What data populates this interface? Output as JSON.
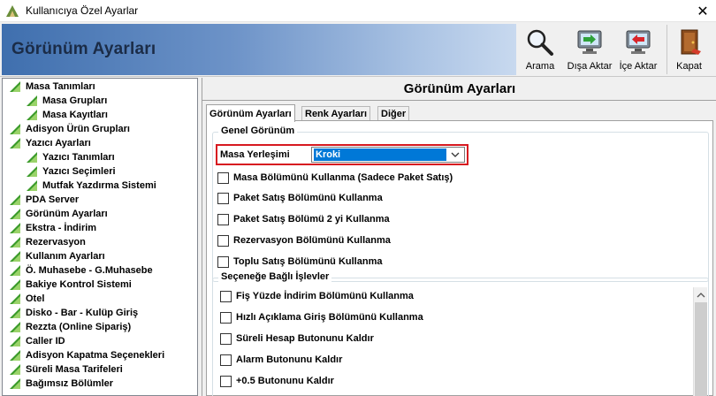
{
  "window": {
    "title": "Kullanıcıya Özel Ayarlar",
    "close_glyph": "✕"
  },
  "header": {
    "title": "Görünüm Ayarları"
  },
  "toolbar": {
    "search": {
      "label": "Arama",
      "icon": "magnifier-icon"
    },
    "export": {
      "label": "Dışa Aktar",
      "icon": "export-monitor-icon"
    },
    "import": {
      "label": "İçe Aktar",
      "icon": "import-monitor-icon"
    },
    "close": {
      "label": "Kapat",
      "icon": "exit-door-icon"
    }
  },
  "tree": [
    {
      "label": "Masa Tanımları",
      "level": 0
    },
    {
      "label": "Masa Grupları",
      "level": 1
    },
    {
      "label": "Masa Kayıtları",
      "level": 1
    },
    {
      "label": "Adisyon Ürün Grupları",
      "level": 0
    },
    {
      "label": "Yazıcı Ayarları",
      "level": 0
    },
    {
      "label": "Yazıcı Tanımları",
      "level": 1
    },
    {
      "label": "Yazıcı Seçimleri",
      "level": 1
    },
    {
      "label": "Mutfak Yazdırma Sistemi",
      "level": 1
    },
    {
      "label": "PDA Server",
      "level": 0
    },
    {
      "label": "Görünüm Ayarları",
      "level": 0
    },
    {
      "label": "Ekstra - İndirim",
      "level": 0
    },
    {
      "label": "Rezervasyon",
      "level": 0
    },
    {
      "label": "Kullanım Ayarları",
      "level": 0
    },
    {
      "label": "Ö. Muhasebe - G.Muhasebe",
      "level": 0
    },
    {
      "label": "Bakiye Kontrol Sistemi",
      "level": 0
    },
    {
      "label": "Otel",
      "level": 0
    },
    {
      "label": "Disko - Bar - Kulüp Giriş",
      "level": 0
    },
    {
      "label": "Rezzta (Online Sipariş)",
      "level": 0
    },
    {
      "label": "Caller ID",
      "level": 0
    },
    {
      "label": "Adisyon Kapatma Seçenekleri",
      "level": 0
    },
    {
      "label": "Süreli Masa Tarifeleri",
      "level": 0
    },
    {
      "label": "Bağımsız Bölümler",
      "level": 0
    }
  ],
  "panel": {
    "title": "Görünüm Ayarları",
    "tabs": [
      "Görünüm Ayarları",
      "Renk Ayarları",
      "Diğer"
    ],
    "active_tab": "Görünüm Ayarları",
    "general_group": {
      "legend": "Genel Görünüm",
      "placement_label": "Masa Yerleşimi",
      "placement_value": "Kroki",
      "checkboxes": [
        {
          "label": "Masa Bölümünü Kullanma (Sadece Paket Satış)",
          "checked": false
        },
        {
          "label": "Paket Satış Bölümünü Kullanma",
          "checked": false
        },
        {
          "label": "Paket Satış Bölümü 2 yi Kullanma",
          "checked": false
        },
        {
          "label": "Rezervasyon Bölümünü Kullanma",
          "checked": false
        },
        {
          "label": "Toplu Satış Bölümünü Kullanma",
          "checked": false
        }
      ]
    },
    "dependent_group": {
      "legend": "Seçeneğe Bağlı İşlevler",
      "checkboxes": [
        {
          "label": "Fiş Yüzde İndirim Bölümünü Kullanma",
          "checked": false
        },
        {
          "label": "Hızlı Açıklama Giriş Bölümünü Kullanma",
          "checked": false
        },
        {
          "label": "Süreli Hesap Butonunu Kaldır",
          "checked": false
        },
        {
          "label": "Alarm Butonunu Kaldır",
          "checked": false
        },
        {
          "label": "+0.5 Butonunu Kaldır",
          "checked": false
        }
      ]
    }
  },
  "colors": {
    "highlight_border": "#d71920",
    "selection": "#0078d7",
    "banner": "#3f6fae",
    "tree_icon": "#3a9a2a"
  }
}
